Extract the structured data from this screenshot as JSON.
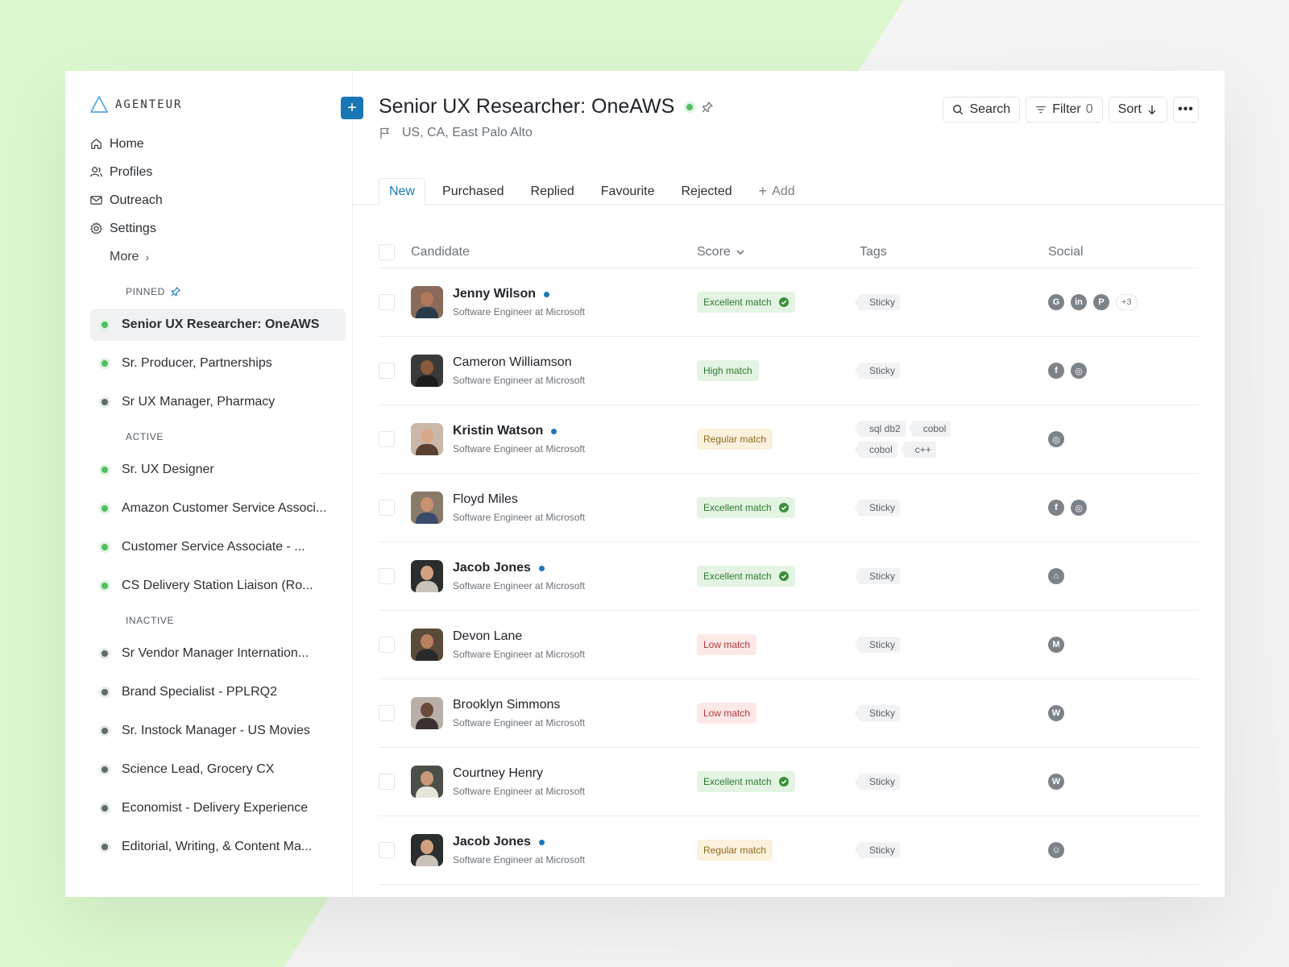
{
  "brand": {
    "name": "AGENTEUR"
  },
  "nav": {
    "items": [
      {
        "label": "Home",
        "icon": "home-icon"
      },
      {
        "label": "Profiles",
        "icon": "users-icon"
      },
      {
        "label": "Outreach",
        "icon": "mail-icon"
      },
      {
        "label": "Settings",
        "icon": "gear-icon"
      }
    ],
    "more_label": "More"
  },
  "sections": {
    "pinned": {
      "label": "PINNED",
      "items": [
        {
          "label": "Senior UX Researcher: OneAWS",
          "status": "green",
          "active": true
        },
        {
          "label": "Sr. Producer, Partnerships",
          "status": "green"
        },
        {
          "label": "Sr UX Manager, Pharmacy",
          "status": "grey"
        }
      ]
    },
    "active": {
      "label": "ACTIVE",
      "items": [
        {
          "label": "Sr. UX Designer",
          "status": "green"
        },
        {
          "label": "Amazon Customer Service Associ...",
          "status": "green"
        },
        {
          "label": "Customer Service Associate - ...",
          "status": "green"
        },
        {
          "label": "CS Delivery Station Liaison (Ro...",
          "status": "green"
        }
      ]
    },
    "inactive": {
      "label": "INACTIVE",
      "items": [
        {
          "label": "Sr Vendor Manager Internation...",
          "status": "grey"
        },
        {
          "label": "Brand Specialist - PPLRQ2",
          "status": "grey"
        },
        {
          "label": "Sr. Instock Manager - US Movies",
          "status": "grey"
        },
        {
          "label": "Science Lead, Grocery CX",
          "status": "grey"
        },
        {
          "label": "Economist - Delivery Experience",
          "status": "grey"
        },
        {
          "label": "Editorial, Writing, & Content Ma...",
          "status": "grey"
        }
      ]
    }
  },
  "header": {
    "title": "Senior UX Researcher: OneAWS",
    "location": "US, CA, East Palo Alto",
    "search_label": "Search",
    "filter_label": "Filter",
    "filter_count": "0",
    "sort_label": "Sort"
  },
  "tabs": [
    {
      "label": "New",
      "active": true
    },
    {
      "label": "Purchased"
    },
    {
      "label": "Replied"
    },
    {
      "label": "Favourite"
    },
    {
      "label": "Rejected"
    }
  ],
  "add_tab_label": "Add",
  "columns": {
    "candidate": "Candidate",
    "score": "Score",
    "tags": "Tags",
    "social": "Social"
  },
  "candidates": [
    {
      "name": "Jenny Wilson",
      "title": "Software Engineer at Microsoft",
      "bold": true,
      "unread": true,
      "score": "Excellent match",
      "level": "excellent",
      "verified": true,
      "tags": [
        "Sticky"
      ],
      "social": [
        "G",
        "in",
        "P"
      ],
      "social_more": "+3",
      "skin": "#b07a5a",
      "shirt": "#2a3a4a",
      "bg": "#8a6a5a"
    },
    {
      "name": "Cameron Williamson",
      "title": "Software Engineer at Microsoft",
      "bold": false,
      "unread": false,
      "score": "High match",
      "level": "high",
      "verified": false,
      "tags": [
        "Sticky"
      ],
      "social": [
        "f",
        "◎"
      ],
      "skin": "#8a5a3a",
      "shirt": "#1d1d1d",
      "bg": "#3a3a3a"
    },
    {
      "name": "Kristin Watson",
      "title": "Software Engineer at Microsoft",
      "bold": true,
      "unread": true,
      "score": "Regular match",
      "level": "regular",
      "verified": false,
      "tags": [
        "sql db2",
        "cobol",
        "cobol",
        "c++"
      ],
      "social": [
        "◎"
      ],
      "skin": "#d9a888",
      "shirt": "#5a4030",
      "bg": "#c9b8a8"
    },
    {
      "name": "Floyd Miles",
      "title": "Software Engineer at Microsoft",
      "bold": false,
      "unread": false,
      "score": "Excellent match",
      "level": "excellent",
      "verified": true,
      "tags": [
        "Sticky"
      ],
      "social": [
        "f",
        "◎"
      ],
      "skin": "#c99070",
      "shirt": "#3a4a6a",
      "bg": "#8a7a6a"
    },
    {
      "name": "Jacob Jones",
      "title": "Software Engineer at Microsoft",
      "bold": true,
      "unread": true,
      "score": "Excellent match",
      "level": "excellent",
      "verified": true,
      "tags": [
        "Sticky"
      ],
      "social": [
        "⌂"
      ],
      "skin": "#d0a080",
      "shirt": "#c9c2b8",
      "bg": "#2a2e2e"
    },
    {
      "name": "Devon Lane",
      "title": "Software Engineer at Microsoft",
      "bold": false,
      "unread": false,
      "score": "Low match",
      "level": "low",
      "verified": false,
      "tags": [
        "Sticky"
      ],
      "social": [
        "M"
      ],
      "skin": "#b88060",
      "shirt": "#2a2a2a",
      "bg": "#5a4a3a"
    },
    {
      "name": "Brooklyn Simmons",
      "title": "Software Engineer at Microsoft",
      "bold": false,
      "unread": false,
      "score": "Low match",
      "level": "low",
      "verified": false,
      "tags": [
        "Sticky"
      ],
      "social": [
        "W"
      ],
      "skin": "#6a4a3a",
      "shirt": "#3a3030",
      "bg": "#b8b0a8"
    },
    {
      "name": "Courtney Henry",
      "title": "Software Engineer at Microsoft",
      "bold": false,
      "unread": false,
      "score": "Excellent match",
      "level": "excellent",
      "verified": true,
      "tags": [
        "Sticky"
      ],
      "social": [
        "W"
      ],
      "skin": "#c89878",
      "shirt": "#e8e4dc",
      "bg": "#4a5048"
    },
    {
      "name": "Jacob Jones",
      "title": "Software Engineer at Microsoft",
      "bold": true,
      "unread": true,
      "score": "Regular match",
      "level": "regular",
      "verified": false,
      "tags": [
        "Sticky"
      ],
      "social": [
        "☺"
      ],
      "skin": "#d0a080",
      "shirt": "#c9c2b8",
      "bg": "#2a2e2e"
    }
  ],
  "colors": {
    "accent": "#1a77b5",
    "active_status": "#4fc05f",
    "inactive_status": "#5f6b65"
  }
}
